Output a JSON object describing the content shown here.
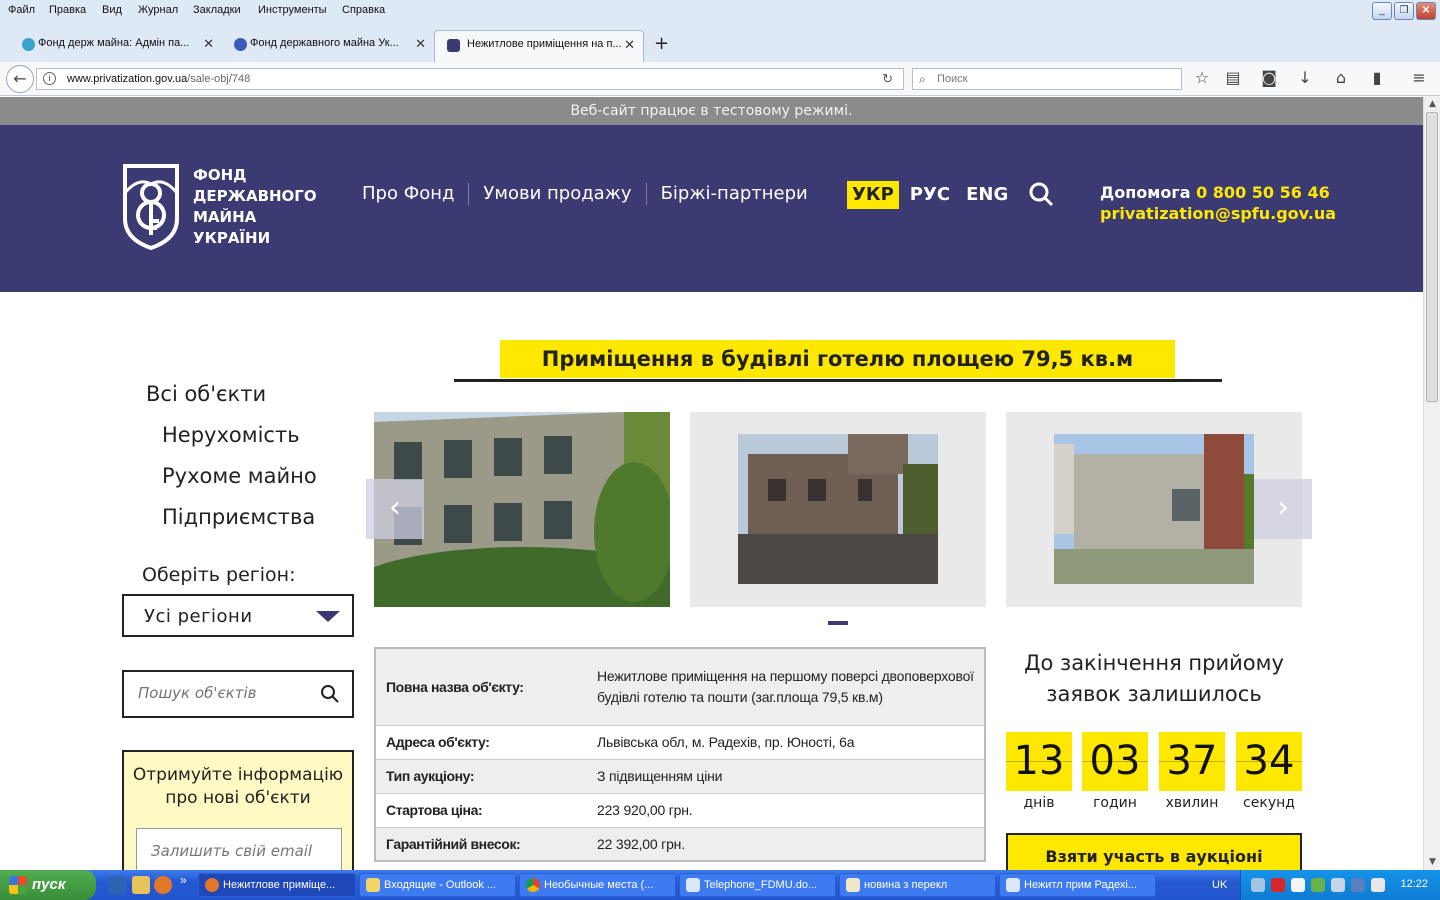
{
  "browser": {
    "menu": [
      "Файл",
      "Правка",
      "Вид",
      "Журнал",
      "Закладки",
      "Инструменты",
      "Справка"
    ],
    "tabs": [
      {
        "label": "Фонд держ майна: Адмін па..."
      },
      {
        "label": "Фонд державного майна Ук..."
      },
      {
        "label": "Нежитлове приміщення на п..."
      }
    ],
    "url_host": "www.privatization.gov.ua",
    "url_path": "/sale-obj/748",
    "search_placeholder": "Поиск"
  },
  "site": {
    "test_banner": "Веб-сайт працює в тестовому режимі.",
    "logo_lines": [
      "ФОНД",
      "ДЕРЖАВНОГО",
      "МАЙНА",
      "УКРАЇНИ"
    ],
    "nav": [
      "Про Фонд",
      "Умови продажу",
      "Біржі-партнери"
    ],
    "langs": [
      "УКР",
      "РУС",
      "ENG"
    ],
    "help_label": "Допомога",
    "help_phone": "0 800 50 56 46",
    "help_email": "privatization@spfu.gov.ua",
    "colors": {
      "header": "#3b3a72",
      "accent": "#ffe800"
    }
  },
  "sidebar": {
    "categories": [
      {
        "label": "Всі об'єкти",
        "level": 0
      },
      {
        "label": "Нерухомість",
        "level": 1
      },
      {
        "label": "Рухоме майно",
        "level": 1
      },
      {
        "label": "Підприємства",
        "level": 1
      }
    ],
    "region_label": "Оберіть регіон:",
    "region_value": "Усі регіони",
    "search_placeholder": "Пошук об'єктів",
    "subscribe_text": "Отримуйте інформацію про нові об'єкти",
    "email_placeholder": "Залишить свій email"
  },
  "object": {
    "title": "Приміщення в будівлі готелю площею 79,5 кв.м",
    "rows": [
      {
        "key": "Повна назва об'єкту:",
        "value": "Нежитлове приміщення на першому поверсі двоповерхової будівлі готелю та пошти (заг.площа 79,5 кв.м)"
      },
      {
        "key": "Адреса об'єкту:",
        "value": "Львівська обл, м. Радехів, пр. Юності, 6а"
      },
      {
        "key": "Тип аукціону:",
        "value": "З підвищенням ціни"
      },
      {
        "key": "Стартова ціна:",
        "value": "223 920,00 грн."
      },
      {
        "key": "Гарантійний внесок:",
        "value": "22 392,00 грн."
      }
    ]
  },
  "countdown": {
    "title": "До закінчення прийому заявок залишилось",
    "units": [
      {
        "value": "13",
        "label": "днів"
      },
      {
        "value": "03",
        "label": "годин"
      },
      {
        "value": "37",
        "label": "хвилин"
      },
      {
        "value": "34",
        "label": "секунд"
      }
    ],
    "join_label": "Взяти участь в аукціоні"
  },
  "taskbar": {
    "start": "пуск",
    "tasks": [
      {
        "label": "Нежитлове приміще..."
      },
      {
        "label": "Входящие - Outlook ..."
      },
      {
        "label": "Необычные места (..."
      },
      {
        "label": "Telephone_FDMU.do..."
      },
      {
        "label": "новина з перекл"
      },
      {
        "label": "Нежитл прим Радехі..."
      }
    ],
    "lang": "UK",
    "clock": "12:22"
  }
}
